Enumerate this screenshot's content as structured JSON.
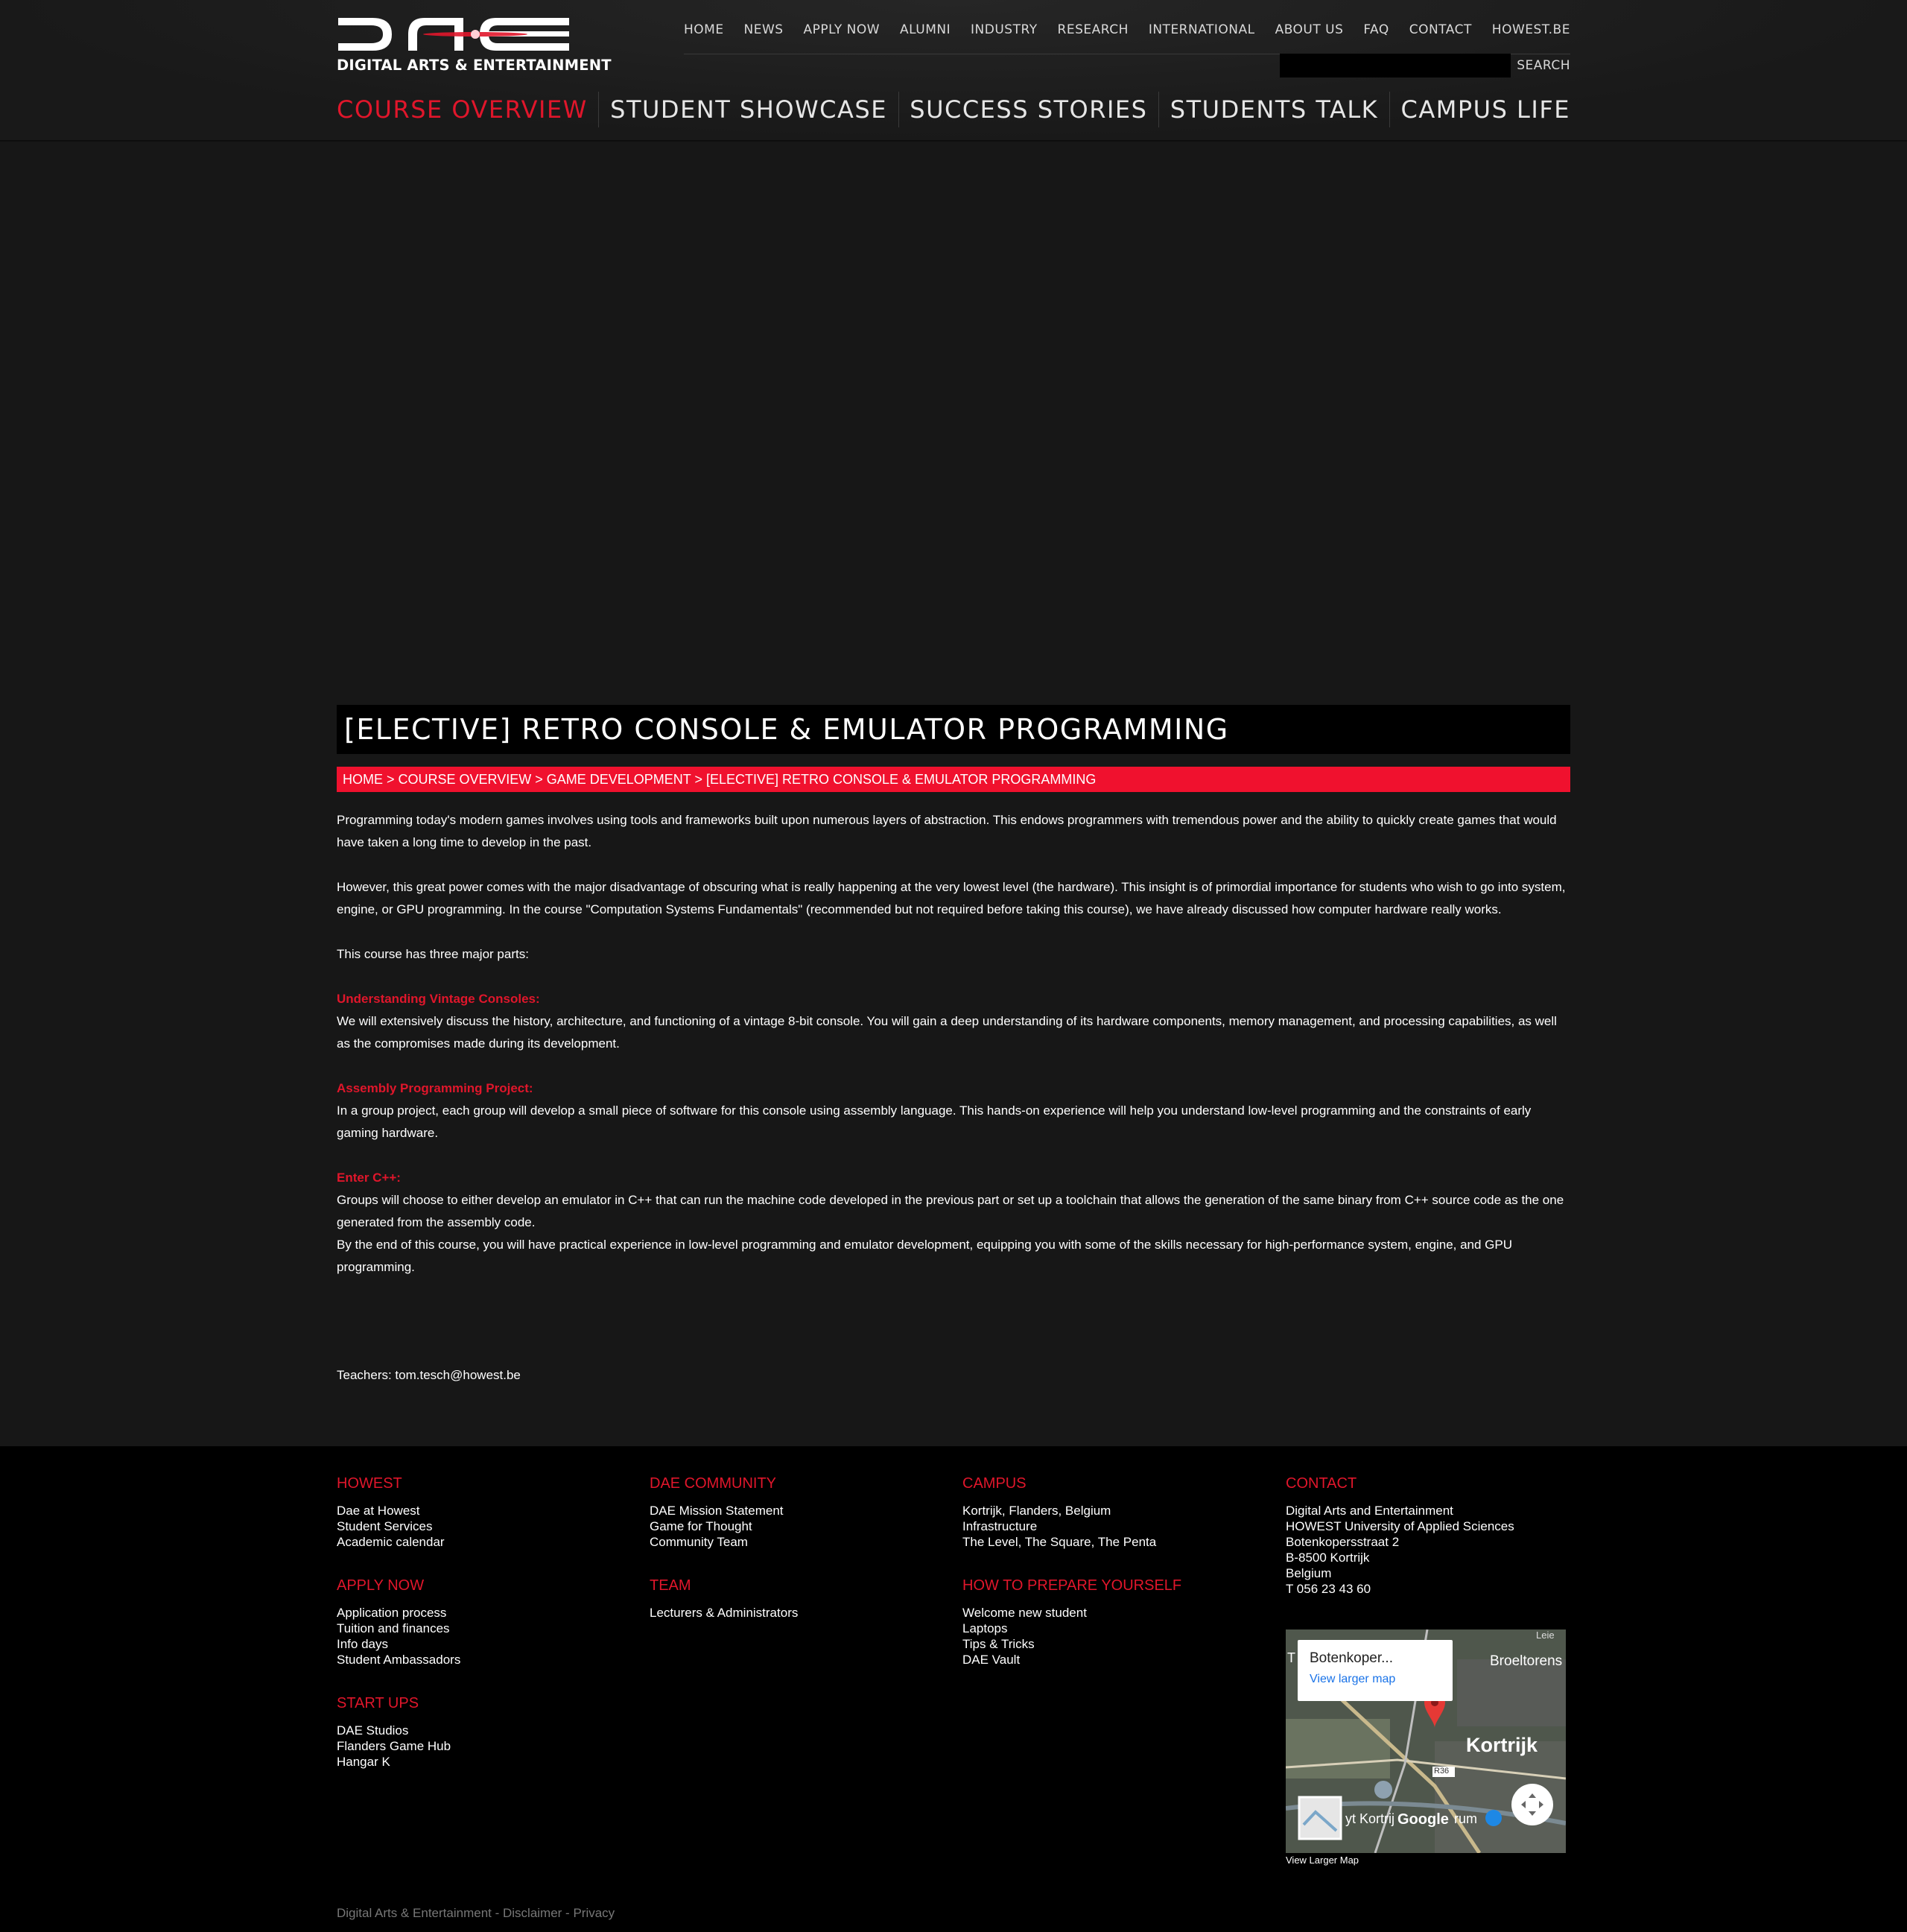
{
  "brand": {
    "logo_text": "DIGITAL ARTS & ENTERTAINMENT"
  },
  "top_nav": [
    "HOME",
    "NEWS",
    "APPLY NOW",
    "ALUMNI",
    "INDUSTRY",
    "RESEARCH",
    "INTERNATIONAL",
    "ABOUT US",
    "FAQ",
    "CONTACT",
    "HOWEST.BE"
  ],
  "search": {
    "label": "SEARCH",
    "value": ""
  },
  "main_nav": [
    {
      "label": "COURSE OVERVIEW",
      "active": true
    },
    {
      "label": "STUDENT SHOWCASE",
      "active": false
    },
    {
      "label": "SUCCESS STORIES",
      "active": false
    },
    {
      "label": "STUDENTS TALK",
      "active": false
    },
    {
      "label": "CAMPUS LIFE",
      "active": false
    }
  ],
  "page": {
    "title": "[ELECTIVE] RETRO CONSOLE & EMULATOR PROGRAMMING",
    "breadcrumb": "HOME > COURSE OVERVIEW > GAME DEVELOPMENT > [ELECTIVE] RETRO CONSOLE & EMULATOR PROGRAMMING",
    "p1": "Programming today's modern games involves using tools and frameworks built upon numerous layers of abstraction. This endows programmers with tremendous power and the ability to quickly create games that would have taken a long time to develop in the past.",
    "p2": "However, this great power comes with the major disadvantage of obscuring what is really happening at the very lowest level (the hardware). This insight is of primordial importance for students who wish to go into system, engine, or GPU programming. In the course \"Computation Systems Fundamentals\" (recommended but not required before taking this course), we have already discussed how computer hardware really works.",
    "p3": "This course has three major parts:",
    "h1": "Understanding Vintage Consoles:",
    "h1_text": "We will extensively discuss the history, architecture, and functioning of a vintage 8-bit console. You will gain a deep understanding of its hardware components, memory management, and processing capabilities, as well as the compromises made during its development.",
    "h2": "Assembly Programming Project:",
    "h2_text": "In a group project, each group will develop a small piece of software for this console using assembly language. This hands-on experience will help you understand low-level programming and the constraints of early gaming hardware.",
    "h3": "Enter C++:",
    "h3_text": "Groups will choose to either develop an emulator in C++ that can run the machine code developed in the previous part or set up a toolchain that allows the generation of the same binary from C++ source code as the one generated from the assembly code.",
    "closing": "By the end of this course, you will have practical experience in low-level programming and emulator development, equipping you with some of the skills necessary for high-performance system, engine, and GPU programming.",
    "teachers": "Teachers: tom.tesch@howest.be"
  },
  "footer": {
    "howest": {
      "title": "HOWEST",
      "items": [
        "Dae at Howest",
        "Student Services",
        "Academic calendar"
      ]
    },
    "apply": {
      "title": "APPLY NOW",
      "items": [
        "Application process",
        "Tuition and finances",
        "Info days",
        "Student Ambassadors"
      ]
    },
    "startups": {
      "title": "START UPS",
      "items": [
        "DAE Studios",
        "Flanders Game Hub",
        "Hangar K"
      ]
    },
    "community": {
      "title": "DAE COMMUNITY",
      "items": [
        "DAE Mission Statement",
        "Game for Thought",
        "Community Team"
      ]
    },
    "team": {
      "title": "TEAM",
      "items": [
        "Lecturers & Administrators"
      ]
    },
    "campus": {
      "title": "CAMPUS",
      "items": [
        "Kortrijk, Flanders, Belgium",
        "Infrastructure",
        "The Level, The Square, The Penta"
      ]
    },
    "prepare": {
      "title": "HOW TO PREPARE YOURSELF",
      "items": [
        "Welcome new student",
        "Laptops",
        "Tips & Tricks",
        "DAE Vault"
      ]
    },
    "contact": {
      "title": "CONTACT",
      "lines": [
        "Digital Arts and Entertainment",
        "HOWEST University of Applied Sciences",
        "Botenkopersstraat 2",
        "B-8500 Kortrijk",
        "Belgium",
        "T 056 23 43 60"
      ]
    },
    "map": {
      "popup_title": "Botenkoper...",
      "popup_link": "View larger map",
      "label_city": "Kortrijk",
      "label_place": "Broeltorens",
      "label_road": "R36",
      "label_google": "Google",
      "label_street": "yt Kortrij",
      "label_rum": "rum",
      "label_t": "T",
      "label_lei": "Leie",
      "below": "View Larger Map"
    },
    "bottom": [
      "Digital Arts & Entertainment",
      "Disclaimer",
      "Privacy"
    ]
  }
}
